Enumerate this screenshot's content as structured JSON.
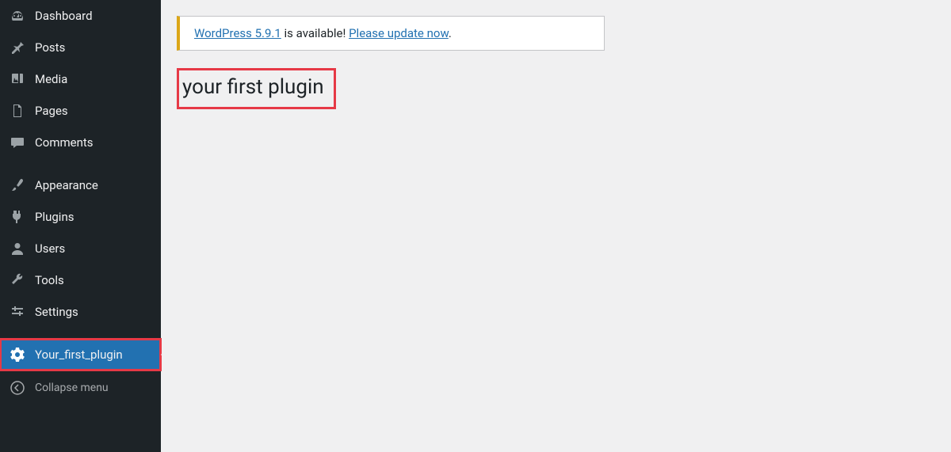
{
  "sidebar": {
    "items": [
      {
        "label": "Dashboard"
      },
      {
        "label": "Posts"
      },
      {
        "label": "Media"
      },
      {
        "label": "Pages"
      },
      {
        "label": "Comments"
      },
      {
        "label": "Appearance"
      },
      {
        "label": "Plugins"
      },
      {
        "label": "Users"
      },
      {
        "label": "Tools"
      },
      {
        "label": "Settings"
      },
      {
        "label": "Your_first_plugin"
      }
    ],
    "collapse": "Collapse menu"
  },
  "notice": {
    "link1": "WordPress 5.9.1",
    "mid": " is available! ",
    "link2": "Please update now",
    "end": "."
  },
  "page": {
    "title": "your first plugin"
  }
}
